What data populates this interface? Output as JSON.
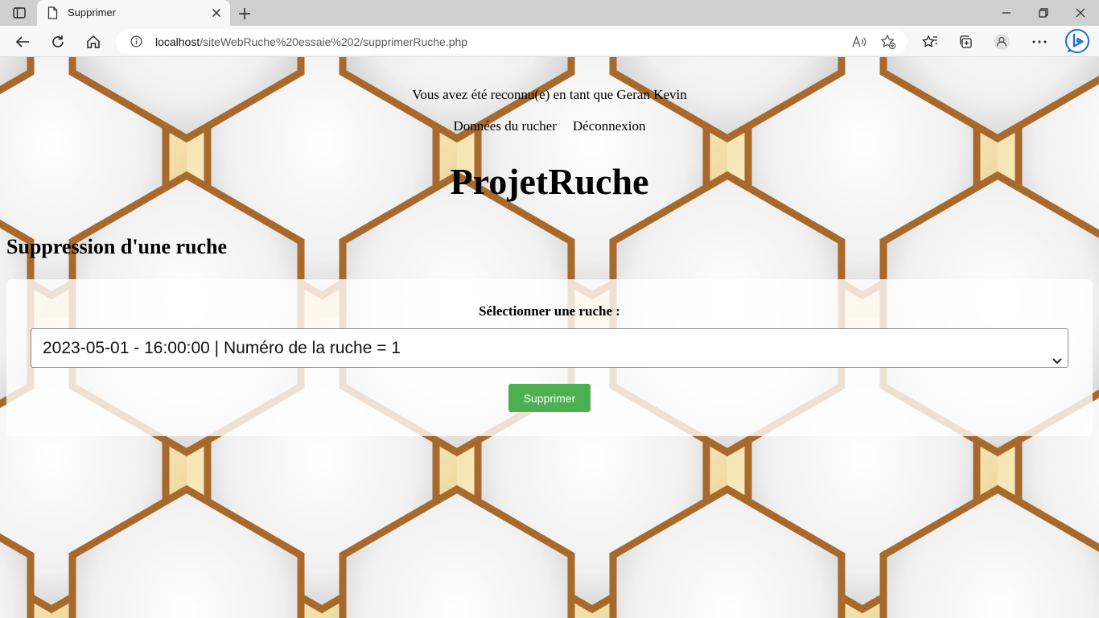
{
  "browser": {
    "tab_title": "Supprimer",
    "url_host": "localhost",
    "url_path": "/siteWebRuche%20essaie%202/supprimerRuche.php"
  },
  "page": {
    "welcome_text": "Vous avez été reconnu(e) en tant que Geran Kevin",
    "menu": [
      {
        "label": "Données du rucher"
      },
      {
        "label": "Déconnexion"
      }
    ],
    "brand": "ProjetRuche",
    "section_title": "Suppression d'une ruche",
    "form": {
      "select_label": "Sélectionner une ruche :",
      "selected_option": "2023-05-01 - 16:00:00 | Numéro de la ruche = 1",
      "submit_label": "Supprimer"
    }
  },
  "colors": {
    "accent_button": "#4caf50",
    "honeycomb_gold": "#e9c97a",
    "honeycomb_bronze": "#a8692c"
  }
}
